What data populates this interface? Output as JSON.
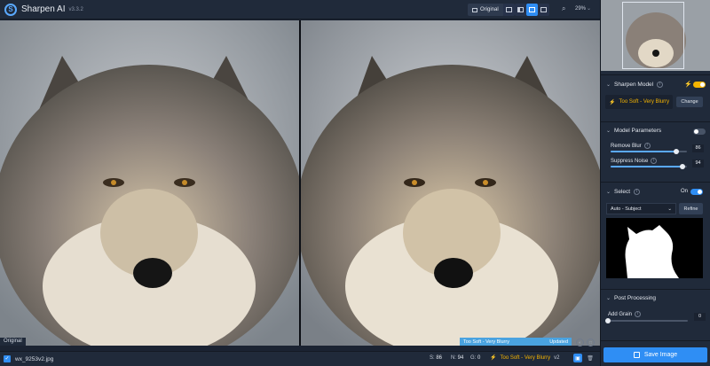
{
  "app": {
    "title": "Sharpen AI",
    "version": "v3.3.2",
    "logo_letter": "S"
  },
  "toolbar": {
    "original_label": "Original",
    "zoom_value": "29%",
    "views": [
      {
        "name": "single-view",
        "active": false
      },
      {
        "name": "split-view",
        "active": false
      },
      {
        "name": "side-by-side-view",
        "active": true
      },
      {
        "name": "grid-view",
        "active": false
      }
    ]
  },
  "viewer": {
    "left_label": "Original",
    "status_model": "Too Soft - Very Blurry",
    "status_state": "Updated"
  },
  "bottombar": {
    "filename": "wx_9253v2.jpg",
    "stats": {
      "s_label": "S:",
      "s_value": "86",
      "n_label": "N:",
      "n_value": "94",
      "g_label": "G:",
      "g_value": "0"
    },
    "model": "Too Soft - Very Blurry",
    "version": "v2"
  },
  "sidebar": {
    "sharpen_model": {
      "title": "Sharpen Model",
      "model_name": "Too Soft - Very Blurry",
      "change_label": "Change",
      "enabled": true
    },
    "model_parameters": {
      "title": "Model Parameters",
      "enabled": false,
      "params": [
        {
          "label": "Remove Blur",
          "value": "86",
          "fraction": 0.86
        },
        {
          "label": "Suppress Noise",
          "value": "94",
          "fraction": 0.94
        }
      ]
    },
    "select": {
      "title": "Select",
      "on_label": "On",
      "enabled": true,
      "mode": "Auto - Subject",
      "refine_label": "Refine"
    },
    "post_processing": {
      "title": "Post Processing",
      "add_grain_label": "Add Grain",
      "add_grain_value": "0",
      "fraction": 0.0
    },
    "save_label": "Save Image"
  },
  "colors": {
    "accent": "#2f8ef4",
    "model_yellow": "#f5b400",
    "panel": "#202a3a"
  }
}
